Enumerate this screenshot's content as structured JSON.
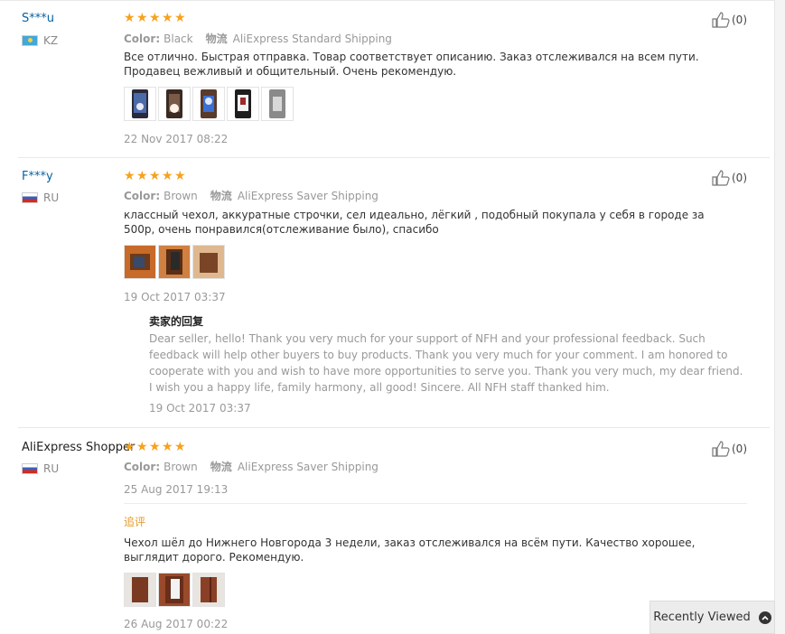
{
  "reviews": [
    {
      "user": "S***u",
      "country": "KZ",
      "rating": 5,
      "color_label": "Color:",
      "color_value": "Black",
      "shipping_cn": "物流",
      "shipping": "AliExpress Standard Shipping",
      "text": "Все отлично. Быстрая отправка. Товар соответствует описанию. Заказ отслеживался на всем пути. Продавец вежливый и общительный. Очень рекомендую.",
      "photos": 5,
      "date": "22 Nov 2017 08:22",
      "likes": "(0)"
    },
    {
      "user": "F***y",
      "country": "RU",
      "rating": 5,
      "color_label": "Color:",
      "color_value": "Brown",
      "shipping_cn": "物流",
      "shipping": "AliExpress Saver Shipping",
      "text": "классный чехол, аккуратные строчки, сел идеально, лёгкий , подобный покупала у себя в городе за 500р, очень понравился(отслеживание было), спасибо",
      "photos": 3,
      "date": "19 Oct 2017 03:37",
      "likes": "(0)",
      "reply_title": "卖家的回复",
      "reply_text": "Dear seller, hello! Thank you very much for your support of NFH and your professional feedback. Such feedback will help other buyers to buy products. Thank you very much for your comment. I am honored to cooperate with you and wish to have more opportunities to serve you. Thank you very much, my dear friend. I wish you a happy life, family harmony, all good! Sincere. All NFH staff thanked him.",
      "reply_date": "19 Oct 2017 03:37"
    },
    {
      "user": "AliExpress Shopper",
      "country": "RU",
      "rating": 5,
      "color_label": "Color:",
      "color_value": "Brown",
      "shipping_cn": "物流",
      "shipping": "AliExpress Saver Shipping",
      "date": "25 Aug 2017 19:13",
      "likes": "(0)",
      "followup_title": "追评",
      "followup_text": "Чехол шёл до Нижнего Новгорода 3 недели, заказ отслеживался на всём пути. Качество хорошее, выглядит дорого. Рекомендую.",
      "followup_photos": 3,
      "followup_date": "26 Aug 2017 00:22"
    }
  ],
  "recently_viewed": "Recently Viewed",
  "colors": {
    "star": "#f6a21c",
    "link": "#0563a5",
    "followup": "#e39b2c"
  }
}
